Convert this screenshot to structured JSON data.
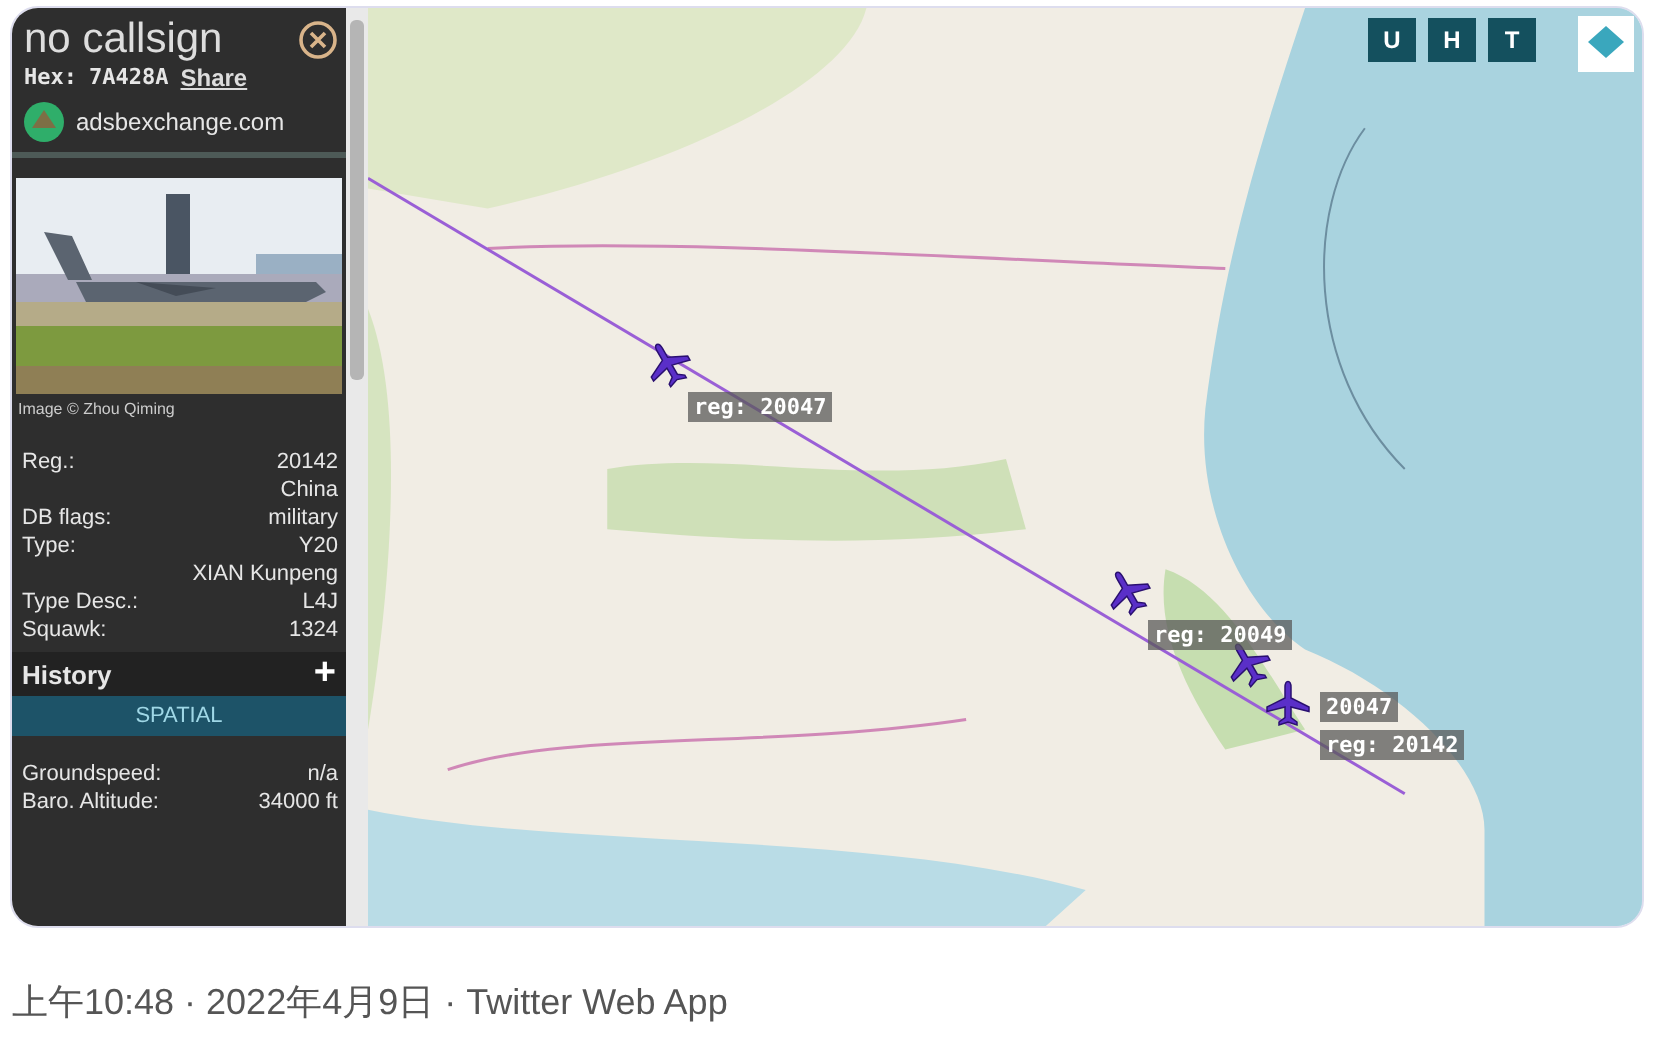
{
  "panel": {
    "title": "no callsign",
    "hex_label": "Hex:",
    "hex": "7A428A",
    "share": "Share",
    "site": "adsbexchange.com",
    "photo_credit": "Image © Zhou Qiming",
    "details": [
      {
        "label": "Reg.:",
        "value": "20142"
      },
      {
        "value": "China"
      },
      {
        "label": "DB flags:",
        "value": "military"
      },
      {
        "label": "Type:",
        "value": "Y20"
      },
      {
        "value": "XIAN Kunpeng"
      },
      {
        "label": "Type Desc.:",
        "value": "L4J"
      },
      {
        "label": "Squawk:",
        "value": "1324"
      }
    ],
    "history": {
      "title": "History",
      "toggle": "+"
    },
    "spatial_button": "SPATIAL",
    "spatial": [
      {
        "label": "Groundspeed:",
        "value": "n/a"
      },
      {
        "label": "Baro. Altitude:",
        "value": "34000 ft"
      }
    ]
  },
  "map": {
    "buttons": [
      "U",
      "H",
      "T"
    ],
    "aircraft": [
      {
        "label": "reg: 20047"
      },
      {
        "label": "reg: 20049"
      },
      {
        "label": "20047"
      },
      {
        "label": "reg: 20142"
      }
    ]
  },
  "footer": "上午10:48 · 2022年4月9日 · Twitter Web App"
}
